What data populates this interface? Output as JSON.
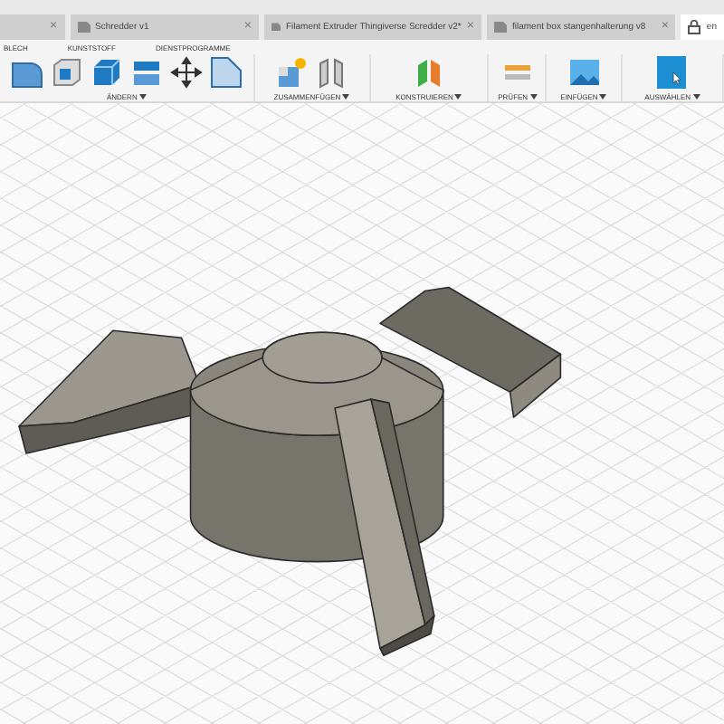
{
  "file_tabs": [
    {
      "close": "×",
      "selected": false
    },
    {
      "label": "Schredder v1",
      "close": "×",
      "selected": false
    },
    {
      "label": "Filament Extruder Thingiverse Scredder v2*",
      "close": "×",
      "selected": false
    },
    {
      "label": "filament box stangenhalterung v8",
      "close": "×",
      "selected": false
    },
    {
      "label": "en",
      "selected": true
    }
  ],
  "ribbon_tabs": [
    {
      "label": "BLECH",
      "selected": false
    },
    {
      "label": "KUNSTSTOFF",
      "selected": false
    },
    {
      "label": "DIENSTPROGRAMME",
      "selected": false
    }
  ],
  "tool_groups": [
    {
      "label": "ÄNDERN"
    },
    {
      "label": "ZUSAMMENFÜGEN"
    },
    {
      "label": "KONSTRUIEREN"
    },
    {
      "label": "PRÜFEN"
    },
    {
      "label": "EINFÜGEN"
    },
    {
      "label": "AUSWÄHLEN"
    }
  ]
}
